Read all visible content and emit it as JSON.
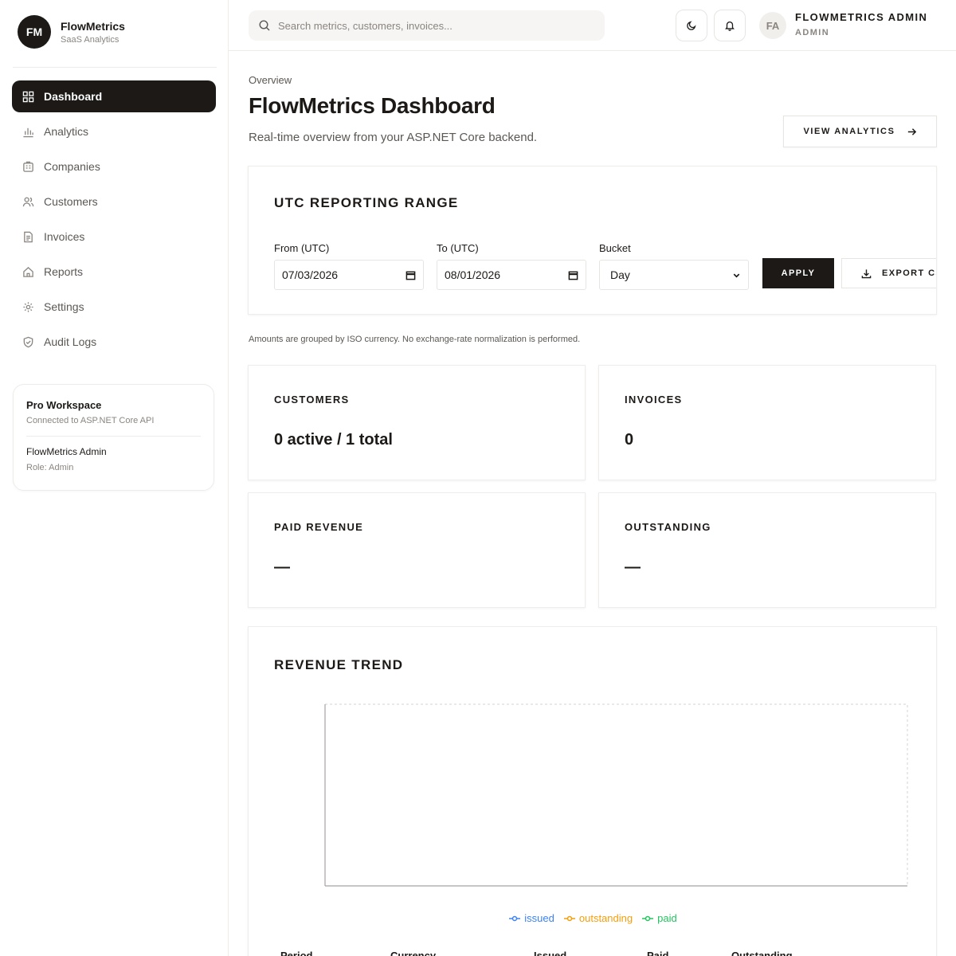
{
  "brand": {
    "initials": "FM",
    "name": "FlowMetrics",
    "subtitle": "SaaS Analytics"
  },
  "sidebar": {
    "items": [
      {
        "label": "Dashboard",
        "icon": "grid-icon",
        "active": true
      },
      {
        "label": "Analytics",
        "icon": "bar-chart-icon"
      },
      {
        "label": "Companies",
        "icon": "building-icon"
      },
      {
        "label": "Customers",
        "icon": "users-icon"
      },
      {
        "label": "Invoices",
        "icon": "file-icon"
      },
      {
        "label": "Reports",
        "icon": "home-icon"
      },
      {
        "label": "Settings",
        "icon": "gear-icon"
      },
      {
        "label": "Audit Logs",
        "icon": "shield-icon"
      }
    ],
    "workspace": {
      "title": "Pro Workspace",
      "subtitle": "Connected to ASP.NET Core API",
      "user": "FlowMetrics Admin",
      "role": "Role: Admin"
    }
  },
  "topbar": {
    "search_placeholder": "Search metrics, customers, invoices...",
    "avatar_initials": "FA",
    "user_name": "FLOWMETRICS ADMIN",
    "user_role": "ADMIN"
  },
  "page": {
    "breadcrumb": "Overview",
    "title": "FlowMetrics Dashboard",
    "subtitle": "Real-time overview from your ASP.NET Core backend.",
    "view_analytics_label": "VIEW ANALYTICS"
  },
  "range": {
    "title": "UTC REPORTING RANGE",
    "from_label": "From (UTC)",
    "from_value": "07/03/2026",
    "to_label": "To (UTC)",
    "to_value": "08/01/2026",
    "bucket_label": "Bucket",
    "bucket_value": "Day",
    "apply_label": "APPLY",
    "export_label": "EXPORT CSV"
  },
  "note": "Amounts are grouped by ISO currency. No exchange-rate normalization is performed.",
  "stats": {
    "customers": {
      "label": "CUSTOMERS",
      "value": "0 active / 1 total"
    },
    "invoices": {
      "label": "INVOICES",
      "value": "0"
    },
    "paid": {
      "label": "PAID REVENUE",
      "value": "—"
    },
    "outstanding": {
      "label": "OUTSTANDING",
      "value": "—"
    }
  },
  "trend": {
    "title": "REVENUE TREND",
    "legend": [
      {
        "name": "issued",
        "color": "#3b82f6"
      },
      {
        "name": "outstanding",
        "color": "#f59e0b"
      },
      {
        "name": "paid",
        "color": "#22c55e"
      }
    ],
    "table_headers": [
      "Period",
      "Currency",
      "Issued",
      "Paid",
      "Outstanding"
    ]
  },
  "colors": {
    "primary": "#1c1917",
    "muted": "#8a8580",
    "border": "#e7e5e2"
  }
}
